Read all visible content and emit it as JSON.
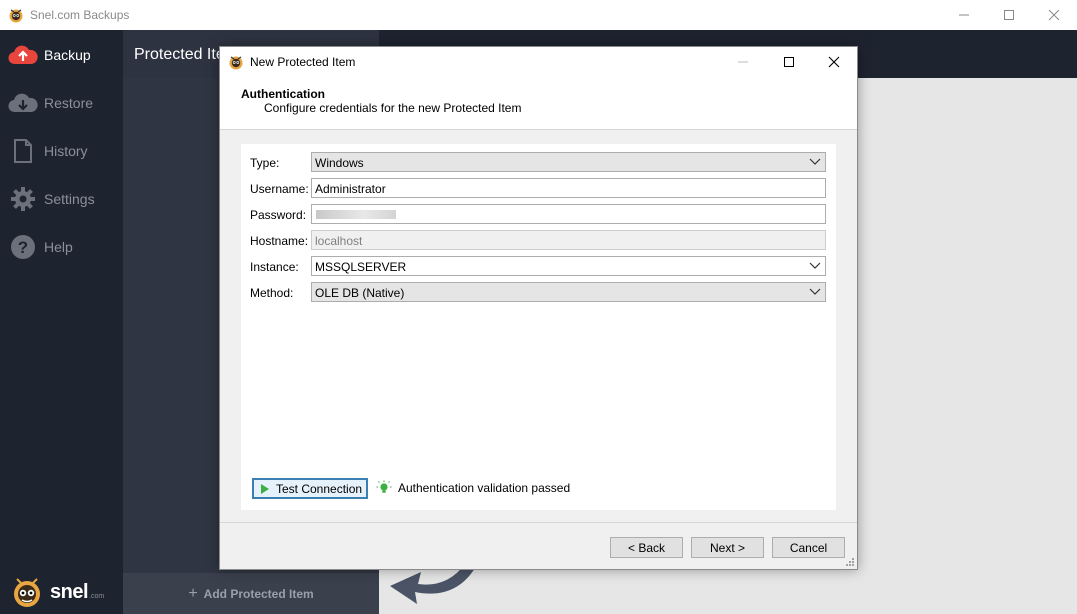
{
  "window": {
    "title": "Snel.com Backups"
  },
  "sidebar": {
    "items": [
      {
        "label": "Backup",
        "icon": "cloud-upload-icon",
        "active": true
      },
      {
        "label": "Restore",
        "icon": "cloud-download-icon",
        "active": false
      },
      {
        "label": "History",
        "icon": "document-icon",
        "active": false
      },
      {
        "label": "Settings",
        "icon": "gear-icon",
        "active": false
      },
      {
        "label": "Help",
        "icon": "help-icon",
        "active": false
      }
    ],
    "logo_text": "snel",
    "logo_sub": ".com"
  },
  "panel": {
    "title": "Protected Items",
    "add_label": "Add Protected Item"
  },
  "dialog": {
    "title": "New Protected Item",
    "header_title": "Authentication",
    "header_subtitle": "Configure credentials for the new Protected Item",
    "fields": {
      "type": {
        "label": "Type:",
        "value": "Windows"
      },
      "username": {
        "label": "Username:",
        "value": "Administrator"
      },
      "password": {
        "label": "Password:",
        "value": ""
      },
      "hostname": {
        "label": "Hostname:",
        "value": "localhost"
      },
      "instance": {
        "label": "Instance:",
        "value": "MSSQLSERVER"
      },
      "method": {
        "label": "Method:",
        "value": "OLE DB (Native)"
      }
    },
    "test_button": "Test Connection",
    "validation_text": "Authentication validation passed",
    "buttons": {
      "back": "< Back",
      "next": "Next >",
      "cancel": "Cancel"
    }
  },
  "colors": {
    "accent_active": "#e8453c",
    "validation_green": "#3cb043",
    "sidebar_bg": "#1e2330"
  }
}
